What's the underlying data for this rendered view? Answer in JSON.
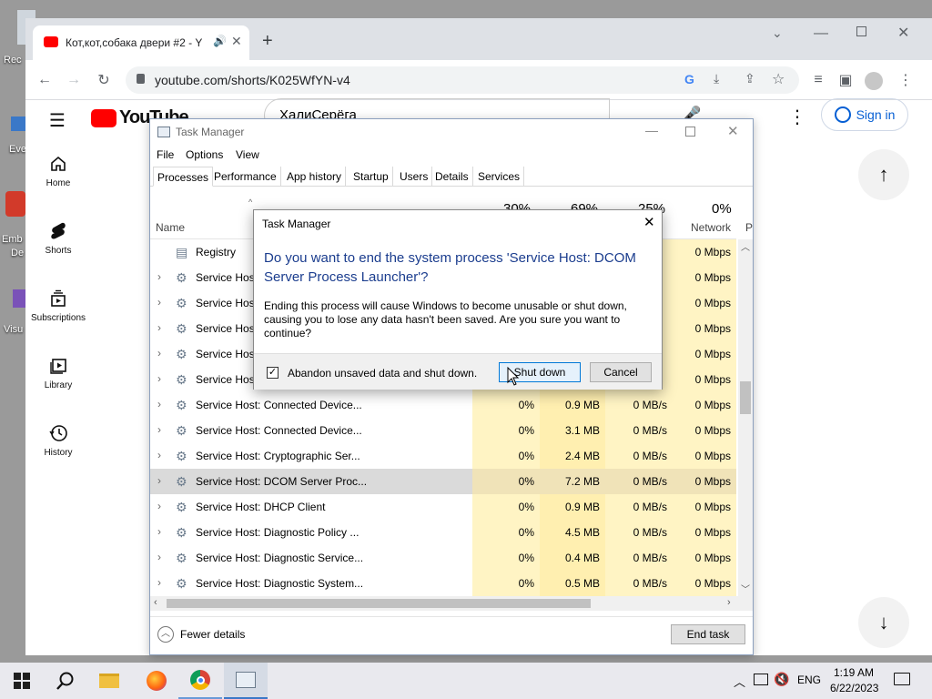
{
  "desktop": {
    "icons": [
      {
        "label": "Rec"
      },
      {
        "label": "Eve"
      },
      {
        "label": "Emb"
      },
      {
        "label": "De"
      },
      {
        "label": "Visu"
      }
    ]
  },
  "browser": {
    "tab_title": "Кот,кот,собака двери #2 - Y",
    "url": "youtube.com/shorts/K025WfYN-v4"
  },
  "youtube": {
    "logo_text": "YouTube",
    "search_value": "ХалиСерёга",
    "nav": [
      {
        "label": "Home"
      },
      {
        "label": "Shorts"
      },
      {
        "label": "Subscriptions"
      },
      {
        "label": "Library"
      },
      {
        "label": "History"
      }
    ],
    "sign_in": "Sign in"
  },
  "taskmanager": {
    "title": "Task Manager",
    "menu": [
      "File",
      "Options",
      "View"
    ],
    "tabs": [
      "Processes",
      "Performance",
      "App history",
      "Startup",
      "Users",
      "Details",
      "Services"
    ],
    "header": {
      "name": "Name",
      "cpu_pct": "30%",
      "mem_pct": "69%",
      "disk_pct": "25%",
      "net_pct": "0%",
      "net": "Network",
      "power_partial": "P"
    },
    "rows": [
      {
        "name": "Registry",
        "cpu": "",
        "mem": "",
        "disk": "",
        "net": "0 Mbps",
        "expand": false,
        "selected": false
      },
      {
        "name": "Service Host",
        "cpu": "",
        "mem": "",
        "disk": "",
        "net": "0 Mbps",
        "expand": true,
        "selected": false
      },
      {
        "name": "Service Host",
        "cpu": "",
        "mem": "",
        "disk": "",
        "net": "0 Mbps",
        "expand": true,
        "selected": false
      },
      {
        "name": "Service Host",
        "cpu": "",
        "mem": "",
        "disk": "",
        "net": "0 Mbps",
        "expand": true,
        "selected": false
      },
      {
        "name": "Service Host",
        "cpu": "",
        "mem": "",
        "disk": "",
        "net": "0 Mbps",
        "expand": true,
        "selected": false
      },
      {
        "name": "Service Host",
        "cpu": "",
        "mem": "",
        "disk": "",
        "net": "0 Mbps",
        "expand": true,
        "selected": false
      },
      {
        "name": "Service Host: Connected Device...",
        "cpu": "0%",
        "mem": "0.9 MB",
        "disk": "0 MB/s",
        "net": "0 Mbps",
        "expand": true,
        "selected": false
      },
      {
        "name": "Service Host: Connected Device...",
        "cpu": "0%",
        "mem": "3.1 MB",
        "disk": "0 MB/s",
        "net": "0 Mbps",
        "expand": true,
        "selected": false
      },
      {
        "name": "Service Host: Cryptographic Ser...",
        "cpu": "0%",
        "mem": "2.4 MB",
        "disk": "0 MB/s",
        "net": "0 Mbps",
        "expand": true,
        "selected": false
      },
      {
        "name": "Service Host: DCOM Server Proc...",
        "cpu": "0%",
        "mem": "7.2 MB",
        "disk": "0 MB/s",
        "net": "0 Mbps",
        "expand": true,
        "selected": true
      },
      {
        "name": "Service Host: DHCP Client",
        "cpu": "0%",
        "mem": "0.9 MB",
        "disk": "0 MB/s",
        "net": "0 Mbps",
        "expand": true,
        "selected": false
      },
      {
        "name": "Service Host: Diagnostic Policy ...",
        "cpu": "0%",
        "mem": "4.5 MB",
        "disk": "0 MB/s",
        "net": "0 Mbps",
        "expand": true,
        "selected": false
      },
      {
        "name": "Service Host: Diagnostic Service...",
        "cpu": "0%",
        "mem": "0.4 MB",
        "disk": "0 MB/s",
        "net": "0 Mbps",
        "expand": true,
        "selected": false
      },
      {
        "name": "Service Host: Diagnostic System...",
        "cpu": "0%",
        "mem": "0.5 MB",
        "disk": "0 MB/s",
        "net": "0 Mbps",
        "expand": true,
        "selected": false
      }
    ],
    "fewer_details": "Fewer details",
    "end_task": "End task"
  },
  "dialog": {
    "title": "Task Manager",
    "question": "Do you want to end the system process 'Service Host: DCOM Server Process Launcher'?",
    "body": "Ending this process will cause Windows to become unusable or shut down, causing you to lose any data hasn't been saved. Are you sure you want to continue?",
    "checkbox_label": "Abandon unsaved data and shut down.",
    "checkbox_checked": true,
    "shutdown_label": "Shut down",
    "cancel_label": "Cancel"
  },
  "taskbar": {
    "lang": "ENG",
    "time": "1:19 AM",
    "date": "6/22/2023"
  }
}
